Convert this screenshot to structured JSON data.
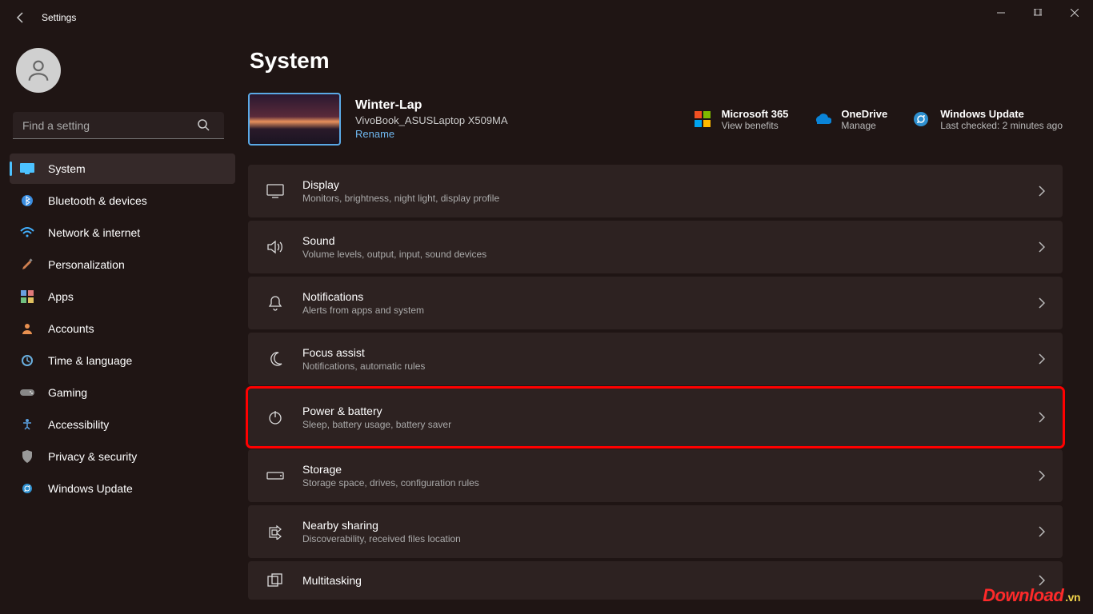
{
  "window": {
    "title": "Settings"
  },
  "sidebar": {
    "search_placeholder": "Find a setting",
    "items": [
      {
        "label": "System"
      },
      {
        "label": "Bluetooth & devices"
      },
      {
        "label": "Network & internet"
      },
      {
        "label": "Personalization"
      },
      {
        "label": "Apps"
      },
      {
        "label": "Accounts"
      },
      {
        "label": "Time & language"
      },
      {
        "label": "Gaming"
      },
      {
        "label": "Accessibility"
      },
      {
        "label": "Privacy & security"
      },
      {
        "label": "Windows Update"
      }
    ]
  },
  "main": {
    "title": "System",
    "device": {
      "name": "Winter-Lap",
      "model": "VivoBook_ASUSLaptop X509MA",
      "rename": "Rename"
    },
    "status": {
      "m365": {
        "title": "Microsoft 365",
        "sub": "View benefits"
      },
      "onedrive": {
        "title": "OneDrive",
        "sub": "Manage"
      },
      "winupd": {
        "title": "Windows Update",
        "sub": "Last checked: 2 minutes ago"
      }
    },
    "cards": [
      {
        "title": "Display",
        "sub": "Monitors, brightness, night light, display profile"
      },
      {
        "title": "Sound",
        "sub": "Volume levels, output, input, sound devices"
      },
      {
        "title": "Notifications",
        "sub": "Alerts from apps and system"
      },
      {
        "title": "Focus assist",
        "sub": "Notifications, automatic rules"
      },
      {
        "title": "Power & battery",
        "sub": "Sleep, battery usage, battery saver"
      },
      {
        "title": "Storage",
        "sub": "Storage space, drives, configuration rules"
      },
      {
        "title": "Nearby sharing",
        "sub": "Discoverability, received files location"
      },
      {
        "title": "Multitasking",
        "sub": ""
      }
    ]
  },
  "watermark": {
    "main": "Download",
    "suffix": ".vn"
  }
}
